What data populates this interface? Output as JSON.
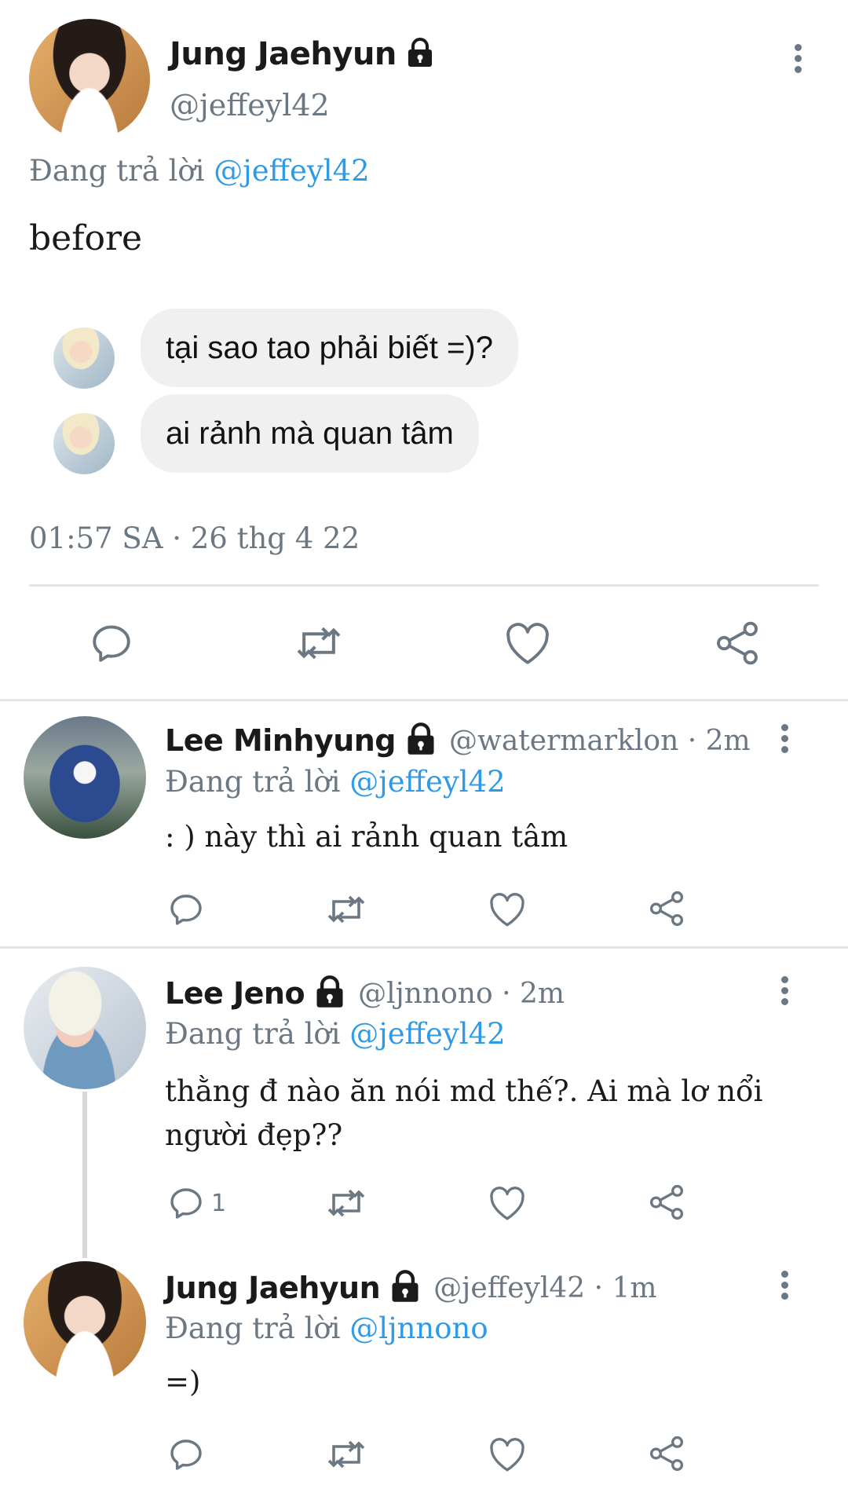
{
  "main_tweet": {
    "name": "Jung Jaehyun",
    "handle": "@jeffeyl42",
    "replying_prefix": "Đang trả lời",
    "replying_to": "@jeffeyl42",
    "text": "before",
    "bubbles": [
      "tại sao tao phải biết =)?",
      "ai rảnh mà quan tâm"
    ],
    "timestamp": "01:57 SA · 26 thg 4 22"
  },
  "replies": [
    {
      "name": "Lee Minhyung",
      "handle": "@watermarklon · 2m",
      "replying_prefix": "Đang trả lời",
      "replying_to": "@jeffeyl42",
      "text": ": ) này thì ai rảnh quan tâm",
      "reply_count": ""
    },
    {
      "name": "Lee Jeno",
      "handle": "@ljnnono · 2m",
      "replying_prefix": "Đang trả lời",
      "replying_to": "@jeffeyl42",
      "text_line1": "thằng đ nào ăn nói md thế?. Ai mà lơ nổi",
      "text_line2": "người đẹp??",
      "reply_count": "1"
    },
    {
      "name": "Jung Jaehyun",
      "handle": "@jeffeyl42 · 1m",
      "replying_prefix": "Đang trả lời",
      "replying_to": "@ljnnono",
      "text": "=)",
      "reply_count": ""
    }
  ],
  "colors": {
    "link": "#2f9be6",
    "icon": "#6b7782"
  }
}
